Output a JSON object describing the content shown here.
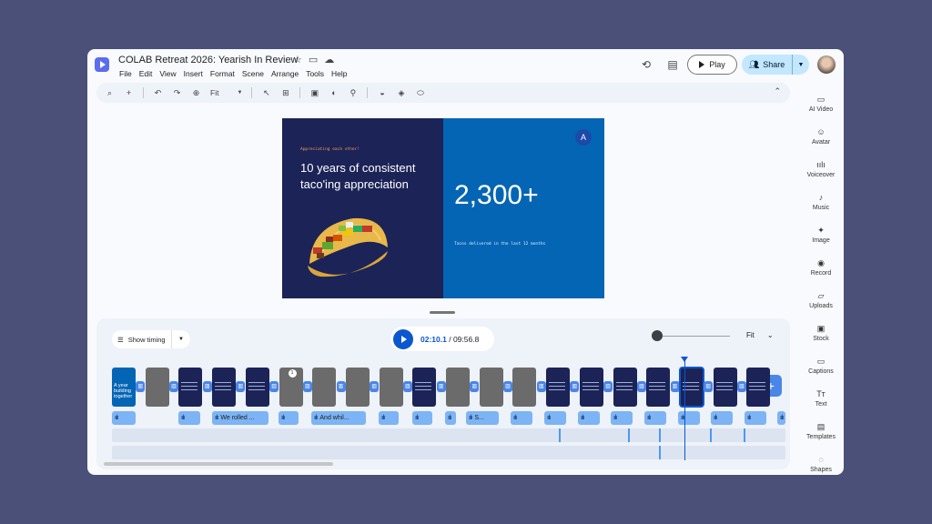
{
  "header": {
    "title": "COLAB Retreat 2026: Yearish In Review",
    "menu": [
      "File",
      "Edit",
      "View",
      "Insert",
      "Format",
      "Scene",
      "Arrange",
      "Tools",
      "Help"
    ],
    "play_label": "Play",
    "share_label": "Share"
  },
  "toolbar": {
    "zoom_value": "Fit"
  },
  "sidebar": {
    "items": [
      {
        "label": "AI Video",
        "icon": "ai-video-icon"
      },
      {
        "label": "Avatar",
        "icon": "avatar-icon"
      },
      {
        "label": "Voiceover",
        "icon": "voiceover-icon"
      },
      {
        "label": "Music",
        "icon": "music-icon"
      },
      {
        "label": "Image",
        "icon": "image-icon"
      },
      {
        "label": "Record",
        "icon": "record-icon"
      },
      {
        "label": "Uploads",
        "icon": "uploads-icon"
      },
      {
        "label": "Stock",
        "icon": "stock-icon"
      },
      {
        "label": "Captions",
        "icon": "captions-icon"
      },
      {
        "label": "Text",
        "icon": "text-icon"
      },
      {
        "label": "Templates",
        "icon": "templates-icon"
      },
      {
        "label": "Shapes",
        "icon": "shapes-icon"
      }
    ]
  },
  "slide": {
    "kicker": "Appreciating each other!",
    "heading": "10 years of consistent taco'ing appreciation",
    "stat": "2,300+",
    "caption": "Tacos delivered in the last 12 months",
    "badge": "A",
    "colors": {
      "left_bg": "#1c2357",
      "right_bg": "#0565b5",
      "accent": "#f09a5a"
    }
  },
  "timeline": {
    "show_timing_label": "Show timing",
    "current_time": "02:10.1",
    "separator": " / ",
    "total_time": "09:56.8",
    "zoom_label": "Fit",
    "first_clip_text": "A year building together",
    "clip_badge": "1",
    "audio_labels": [
      "We rolled ...",
      "And whil...",
      "S..."
    ]
  },
  "colors": {
    "accent": "#0b57d0",
    "share_bg": "#c2e7ff",
    "background": "#4a5078"
  }
}
